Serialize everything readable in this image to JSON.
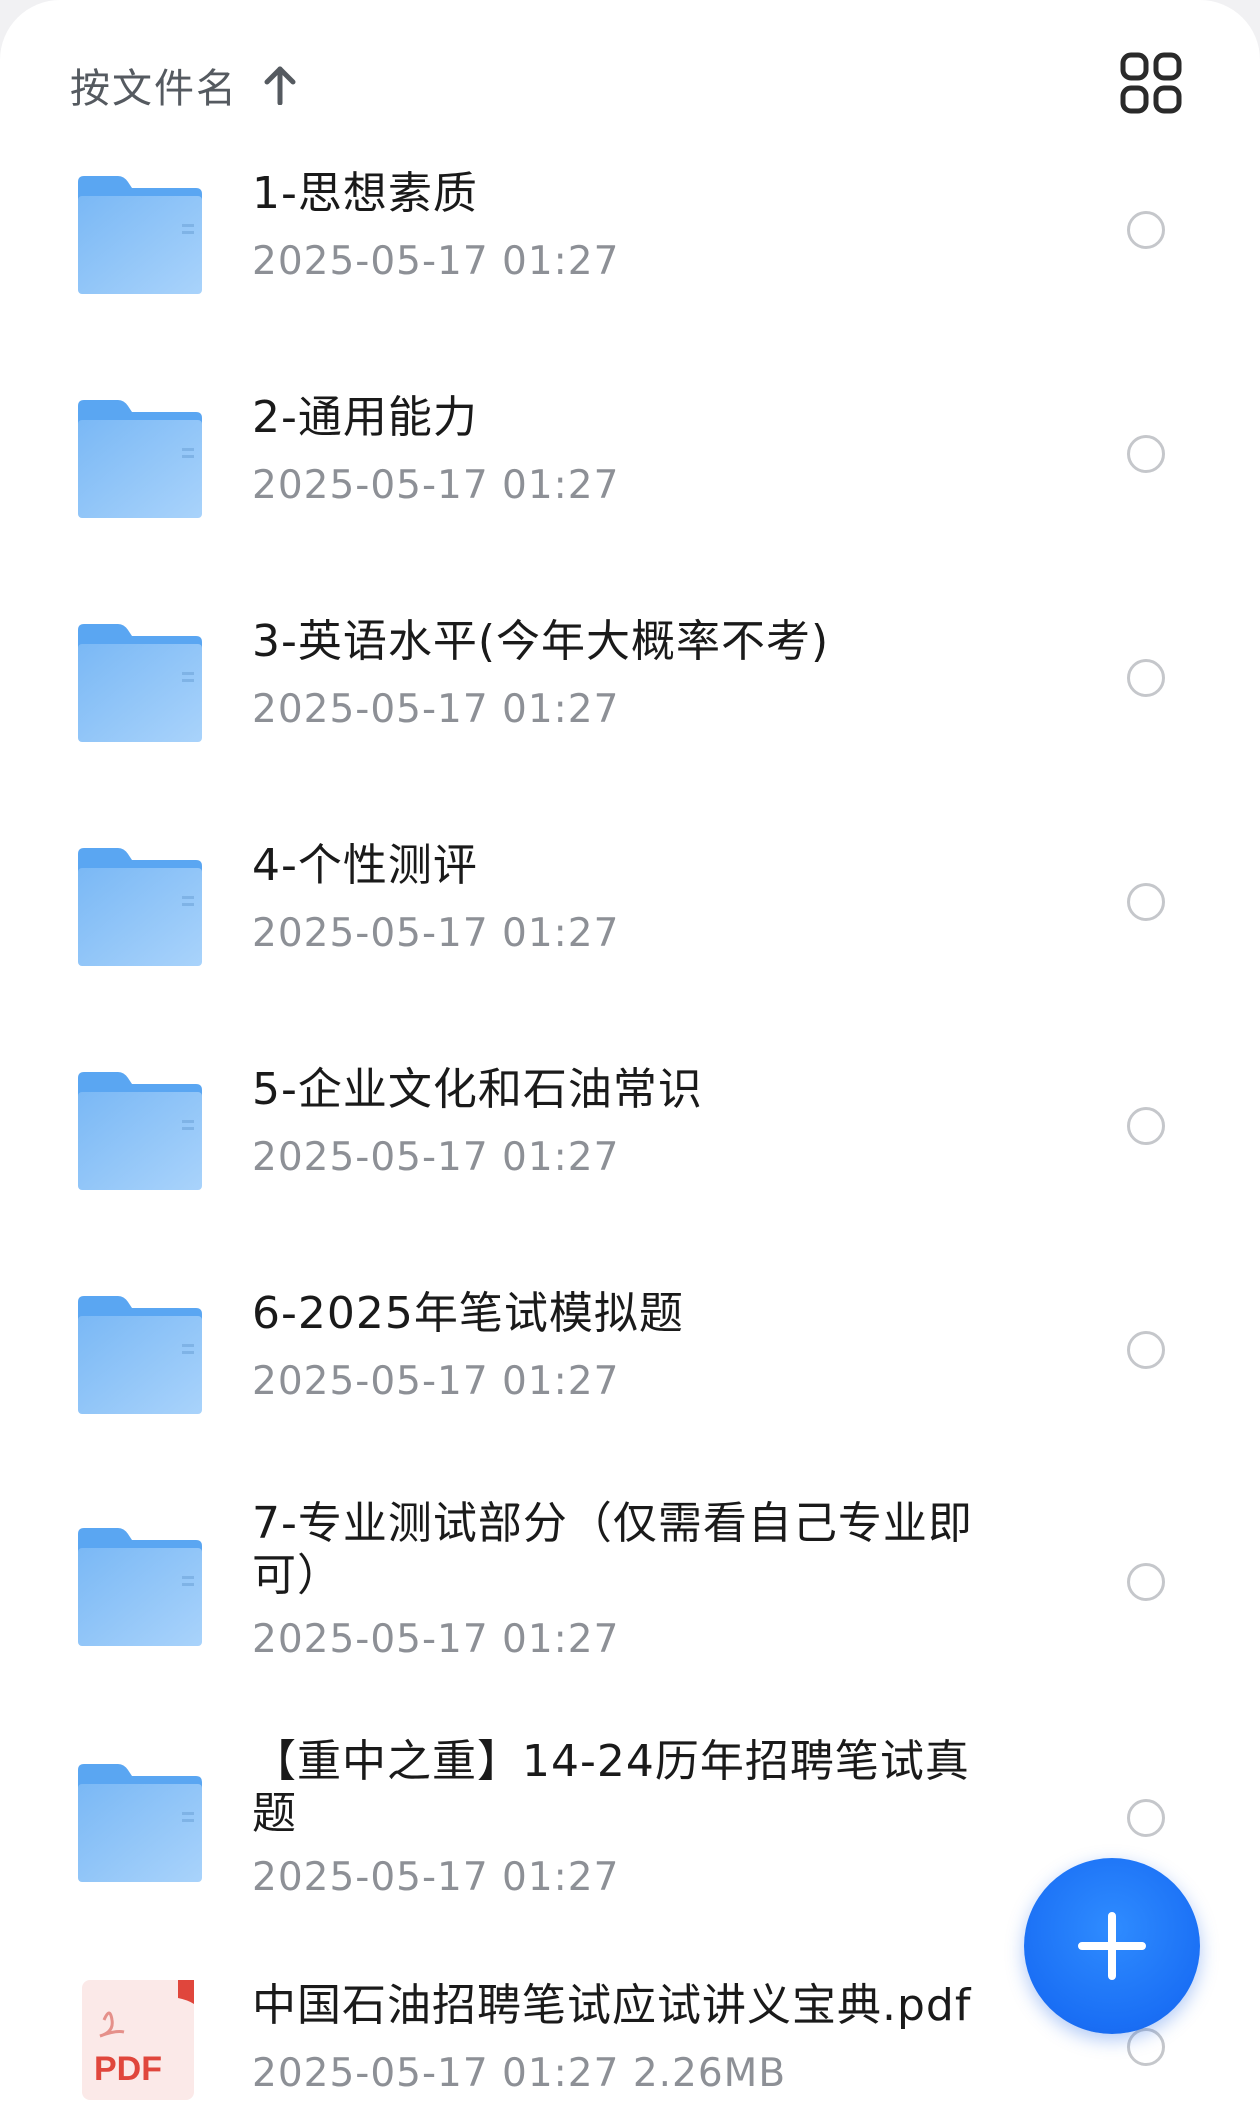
{
  "header": {
    "sort_label": "按文件名",
    "sort_icon": "arrow-up-icon",
    "view_icon": "grid-view-icon"
  },
  "files": [
    {
      "type": "folder",
      "name": "1-思想素质",
      "meta": "2025-05-17 01:27"
    },
    {
      "type": "folder",
      "name": "2-通用能力",
      "meta": "2025-05-17 01:27"
    },
    {
      "type": "folder",
      "name": "3-英语水平(今年大概率不考)",
      "meta": "2025-05-17 01:27"
    },
    {
      "type": "folder",
      "name": "4-个性测评",
      "meta": "2025-05-17 01:27"
    },
    {
      "type": "folder",
      "name": "5-企业文化和石油常识",
      "meta": "2025-05-17 01:27"
    },
    {
      "type": "folder",
      "name": "6-2025年笔试模拟题",
      "meta": "2025-05-17 01:27"
    },
    {
      "type": "folder",
      "name": "7-专业测试部分（仅需看自己专业即可）",
      "meta": "2025-05-17 01:27"
    },
    {
      "type": "folder",
      "name": "【重中之重】14-24历年招聘笔试真题",
      "meta": "2025-05-17 01:27"
    },
    {
      "type": "pdf",
      "name": "中国石油招聘笔试应试讲义宝典.pdf",
      "meta": "2025-05-17 01:27 2.26MB",
      "badge": "PDF"
    }
  ],
  "fab": {
    "icon": "plus-icon"
  },
  "colors": {
    "accent": "#1a6ff5",
    "folder": "#8cc4f7",
    "pdf_red": "#e0463c"
  }
}
